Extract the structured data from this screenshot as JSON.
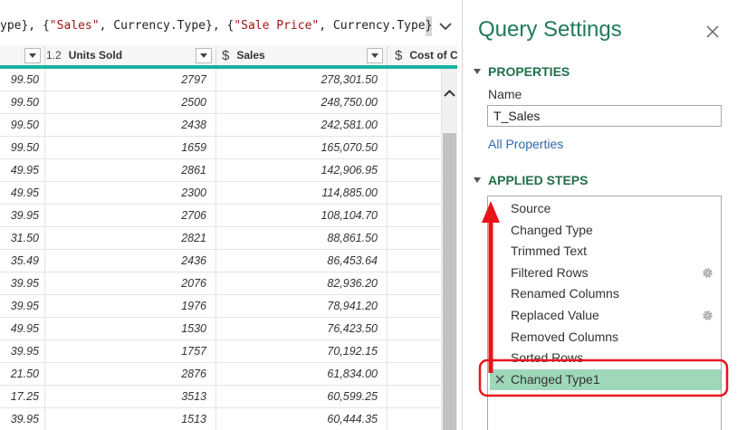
{
  "formula": {
    "seg1": "ype}, {",
    "seg2": "\"Sales\"",
    "seg3": ", Currency.Type}, {",
    "seg4": "\"Sale Price\"",
    "seg5": ", Currency.Type",
    "seg6": "}"
  },
  "grid": {
    "columns": [
      {
        "type_icon": "",
        "label": ""
      },
      {
        "type_icon": "1.2",
        "label": "Units Sold"
      },
      {
        "type_icon": "$",
        "label": "Sales"
      },
      {
        "type_icon": "$",
        "label": "Cost of C"
      }
    ],
    "rows": [
      [
        "99.50",
        "2797",
        "278,301.50"
      ],
      [
        "99.50",
        "2500",
        "248,750.00"
      ],
      [
        "99.50",
        "2438",
        "242,581.00"
      ],
      [
        "99.50",
        "1659",
        "165,070.50"
      ],
      [
        "49.95",
        "2861",
        "142,906.95"
      ],
      [
        "49.95",
        "2300",
        "114,885.00"
      ],
      [
        "39.95",
        "2706",
        "108,104.70"
      ],
      [
        "31.50",
        "2821",
        "88,861.50"
      ],
      [
        "35.49",
        "2436",
        "86,453.64"
      ],
      [
        "39.95",
        "2076",
        "82,936.20"
      ],
      [
        "39.95",
        "1976",
        "78,941.20"
      ],
      [
        "49.95",
        "1530",
        "76,423.50"
      ],
      [
        "39.95",
        "1757",
        "70,192.15"
      ],
      [
        "21.50",
        "2876",
        "61,834.00"
      ],
      [
        "17.25",
        "3513",
        "60,599.25"
      ],
      [
        "39.95",
        "1513",
        "60,444.35"
      ]
    ]
  },
  "panel": {
    "title": "Query Settings",
    "properties_heading": "PROPERTIES",
    "name_label": "Name",
    "name_value": "T_Sales",
    "all_properties_link": "All Properties",
    "applied_steps_heading": "APPLIED STEPS",
    "steps": [
      {
        "label": "Source",
        "has_gear": false,
        "selected": false
      },
      {
        "label": "Changed Type",
        "has_gear": false,
        "selected": false
      },
      {
        "label": "Trimmed Text",
        "has_gear": false,
        "selected": false
      },
      {
        "label": "Filtered Rows",
        "has_gear": true,
        "selected": false
      },
      {
        "label": "Renamed Columns",
        "has_gear": false,
        "selected": false
      },
      {
        "label": "Replaced Value",
        "has_gear": true,
        "selected": false
      },
      {
        "label": "Removed Columns",
        "has_gear": false,
        "selected": false
      },
      {
        "label": "Sorted Rows",
        "has_gear": false,
        "selected": false
      },
      {
        "label": "Changed Type1",
        "has_gear": false,
        "selected": true
      }
    ]
  },
  "colors": {
    "accent_teal": "#17b3a0",
    "heading_green": "#1f6f4a",
    "selected_step": "#9fd8b8",
    "annotation_red": "#e8141a",
    "link_blue": "#2e6ab0"
  }
}
